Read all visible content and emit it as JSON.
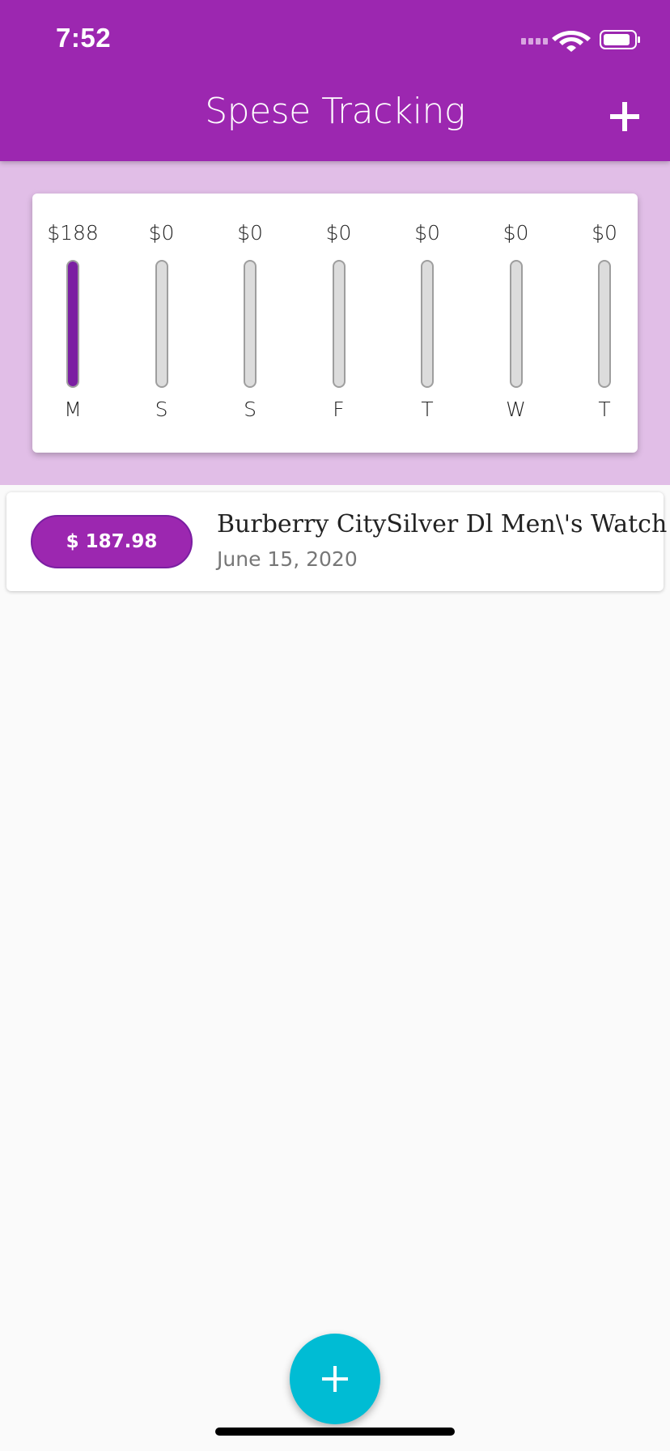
{
  "status_bar": {
    "time": "7:52",
    "icons": [
      "cellular-signal-icon",
      "wifi-icon",
      "battery-icon"
    ]
  },
  "app_bar": {
    "title": "Spese Tracking",
    "add_icon": "plus-icon",
    "color": "#9c27b0"
  },
  "chart_data": {
    "type": "bar",
    "categories": [
      "M",
      "S",
      "S",
      "F",
      "T",
      "W",
      "T"
    ],
    "labels": [
      "$188",
      "$0",
      "$0",
      "$0",
      "$0",
      "$0",
      "$0"
    ],
    "values": [
      187.98,
      0,
      0,
      0,
      0,
      0,
      0
    ],
    "fill_fraction": [
      1.0,
      0,
      0,
      0,
      0,
      0,
      0
    ],
    "bar_color": "#7b1fa2",
    "track_color": "#dcdcdc",
    "background": "#e1bee7"
  },
  "transactions": [
    {
      "amount": "$ 187.98",
      "title": "Burberry CitySilver Dl Men\\'s Watch",
      "date": "June 15, 2020"
    }
  ],
  "fab": {
    "icon": "plus-icon",
    "color": "#00bcd4"
  }
}
